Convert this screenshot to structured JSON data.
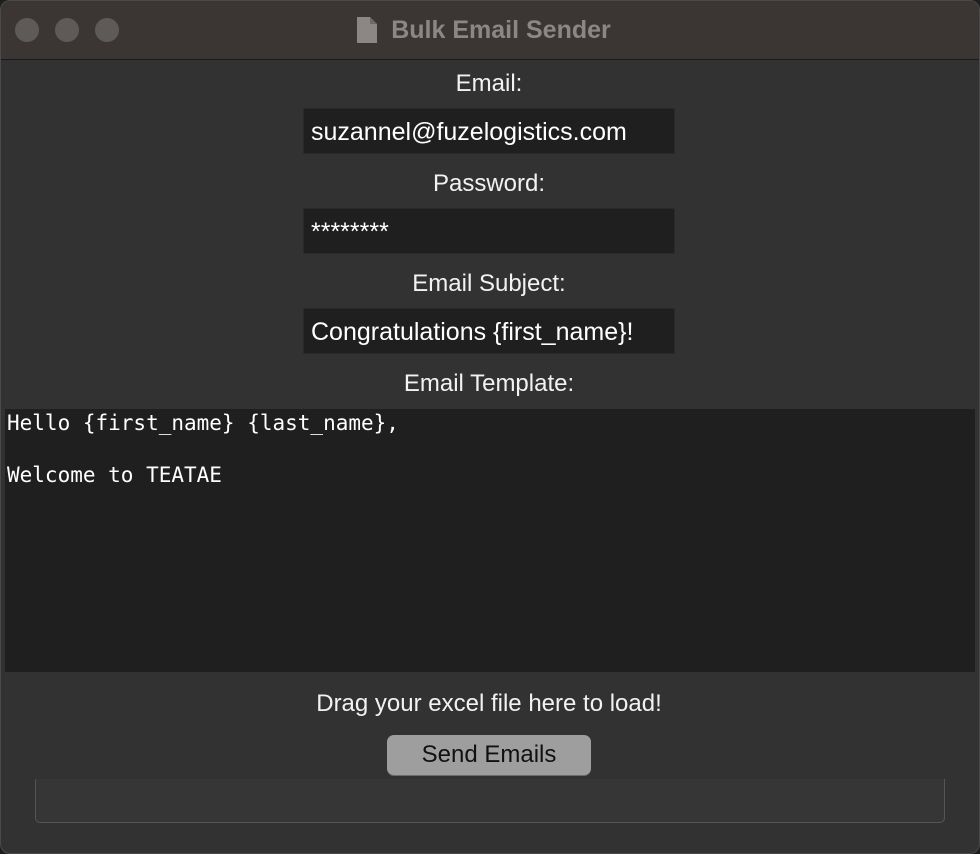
{
  "window": {
    "title": "Bulk Email Sender"
  },
  "form": {
    "email_label": "Email:",
    "email_value": "suzannel@fuzelogistics.com",
    "password_label": "Password:",
    "password_value": "********",
    "subject_label": "Email Subject:",
    "subject_value": "Congratulations {first_name}!",
    "template_label": "Email Template:",
    "template_value": "Hello {first_name} {last_name},\n\nWelcome to TEATAE",
    "drop_hint": "Drag your excel file here to load!",
    "send_label": "Send Emails"
  },
  "icons": {
    "title_icon": "document-icon"
  },
  "colors": {
    "window_bg": "#323232",
    "field_bg": "#1f1f1f",
    "button_bg": "#9e9e9e",
    "titlebar_bg": "#3b3634"
  }
}
